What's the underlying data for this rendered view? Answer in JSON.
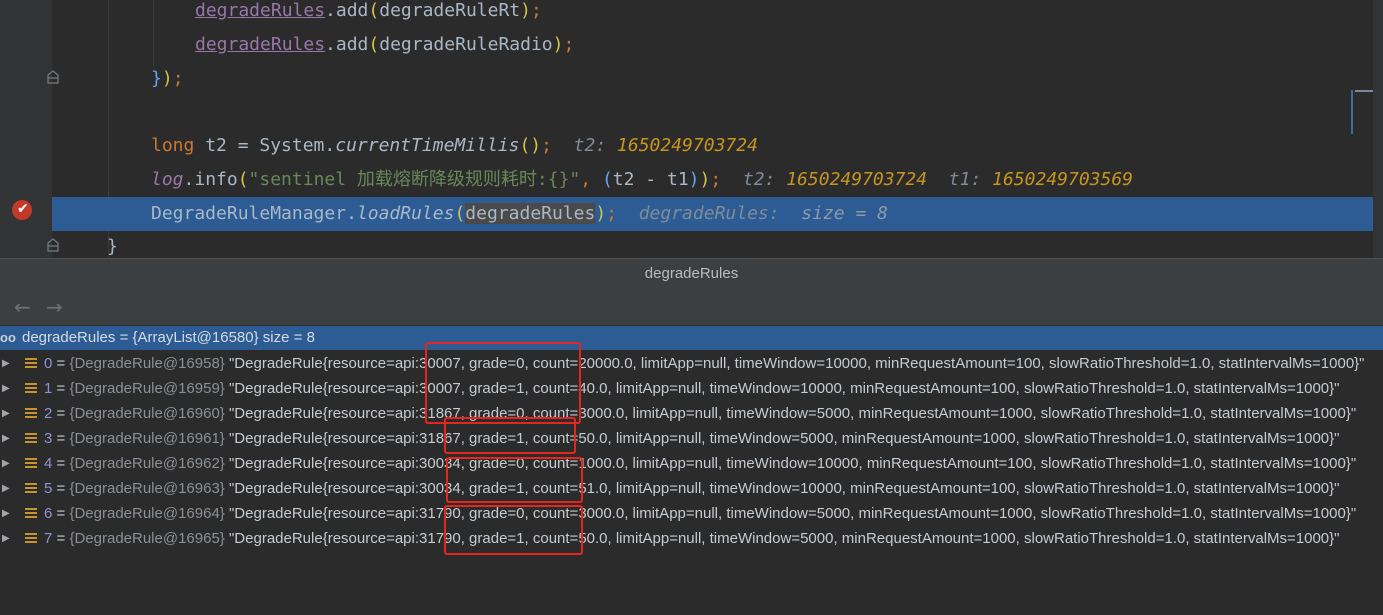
{
  "editor": {
    "lines": [
      {
        "id": "l1",
        "segments": [
          {
            "t": "degradeRules",
            "c": "ref"
          },
          {
            "t": ".add"
          },
          {
            "t": "(",
            "c": "paren-y"
          },
          {
            "t": "degradeRuleRt"
          },
          {
            "t": ")",
            "c": "paren-y"
          },
          {
            "t": ";",
            "c": "kw"
          }
        ]
      },
      {
        "id": "l2",
        "segments": [
          {
            "t": "degradeRules",
            "c": "ref"
          },
          {
            "t": ".add"
          },
          {
            "t": "(",
            "c": "paren-y"
          },
          {
            "t": "degradeRuleRadio"
          },
          {
            "t": ")",
            "c": "paren-y"
          },
          {
            "t": ";",
            "c": "kw"
          }
        ]
      },
      {
        "id": "l3",
        "segments": [
          {
            "t": "}",
            "c": "paren-b"
          },
          {
            "t": ")",
            "c": "paren-y"
          },
          {
            "t": ";",
            "c": "kw"
          }
        ]
      },
      {
        "id": "l4",
        "segments": []
      },
      {
        "id": "l5",
        "segments": [
          {
            "t": "long ",
            "c": "kw"
          },
          {
            "t": "t2 = System."
          },
          {
            "t": "currentTimeMillis",
            "c": "ital"
          },
          {
            "t": "()",
            "c": "paren-y"
          },
          {
            "t": ";",
            "c": "kw"
          },
          {
            "t": "  t2: ",
            "c": "inl-lbl"
          },
          {
            "t": "1650249703724",
            "c": "inl-val"
          }
        ]
      },
      {
        "id": "l6",
        "segments": [
          {
            "t": "log",
            "c": "fld"
          },
          {
            "t": ".info"
          },
          {
            "t": "(",
            "c": "paren-y"
          },
          {
            "t": "\"sentinel 加载熔断降级规则耗时:{}\"",
            "c": "str"
          },
          {
            "t": ", ",
            "c": "kw"
          },
          {
            "t": "(",
            "c": "paren-b"
          },
          {
            "t": "t2 - t1"
          },
          {
            "t": ")",
            "c": "paren-b"
          },
          {
            "t": ")",
            "c": "paren-y"
          },
          {
            "t": ";",
            "c": "kw"
          },
          {
            "t": "  t2: ",
            "c": "inl-lbl"
          },
          {
            "t": "1650249703724",
            "c": "inl-val"
          },
          {
            "t": "  t1: ",
            "c": "inl-lbl"
          },
          {
            "t": "1650249703569",
            "c": "inl-val"
          }
        ]
      },
      {
        "id": "l7",
        "segments": [
          {
            "t": "DegradeRuleManager."
          },
          {
            "t": "loadRules",
            "c": "ital"
          },
          {
            "t": "(",
            "c": "paren-y"
          },
          {
            "t": "degradeRules",
            "c": "match"
          },
          {
            "t": ")",
            "c": "paren-y"
          },
          {
            "t": ";",
            "c": "kw"
          },
          {
            "t": "  degradeRules:  ",
            "c": "inl-lbl"
          },
          {
            "t": "size = 8",
            "c": "inl-val2"
          }
        ]
      },
      {
        "id": "l8",
        "segments": [
          {
            "t": "}"
          }
        ]
      }
    ]
  },
  "debug_panel": {
    "title": "degradeRules",
    "nav_back": "←",
    "nav_forward": "→",
    "root": {
      "icon_label": "oo",
      "label": "degradeRules = {ArrayList@16580}  size = 8"
    },
    "items": [
      {
        "index": "0",
        "obj": "{DegradeRule@16958}",
        "value": "\"DegradeRule{resource=api:30007, grade=0, count=20000.0, limitApp=null, timeWindow=10000, minRequestAmount=100, slowRatioThreshold=1.0, statIntervalMs=1000}\""
      },
      {
        "index": "1",
        "obj": "{DegradeRule@16959}",
        "value": "\"DegradeRule{resource=api:30007, grade=1, count=40.0, limitApp=null, timeWindow=10000, minRequestAmount=100, slowRatioThreshold=1.0, statIntervalMs=1000}\""
      },
      {
        "index": "2",
        "obj": "{DegradeRule@16960}",
        "value": "\"DegradeRule{resource=api:31867, grade=0, count=3000.0, limitApp=null, timeWindow=5000, minRequestAmount=1000, slowRatioThreshold=1.0, statIntervalMs=1000}\""
      },
      {
        "index": "3",
        "obj": "{DegradeRule@16961}",
        "value": "\"DegradeRule{resource=api:31867, grade=1, count=50.0, limitApp=null, timeWindow=5000, minRequestAmount=1000, slowRatioThreshold=1.0, statIntervalMs=1000}\""
      },
      {
        "index": "4",
        "obj": "{DegradeRule@16962}",
        "value": "\"DegradeRule{resource=api:30034, grade=0, count=1000.0, limitApp=null, timeWindow=10000, minRequestAmount=100, slowRatioThreshold=1.0, statIntervalMs=1000}\""
      },
      {
        "index": "5",
        "obj": "{DegradeRule@16963}",
        "value": "\"DegradeRule{resource=api:30034, grade=1, count=51.0, limitApp=null, timeWindow=10000, minRequestAmount=100, slowRatioThreshold=1.0, statIntervalMs=1000}\""
      },
      {
        "index": "6",
        "obj": "{DegradeRule@16964}",
        "value": "\"DegradeRule{resource=api:31790, grade=0, count=3000.0, limitApp=null, timeWindow=5000, minRequestAmount=1000, slowRatioThreshold=1.0, statIntervalMs=1000}\""
      },
      {
        "index": "7",
        "obj": "{DegradeRule@16965}",
        "value": "\"DegradeRule{resource=api:31790, grade=1, count=50.0, limitApp=null, timeWindow=5000, minRequestAmount=1000, slowRatioThreshold=1.0, statIntervalMs=1000}\""
      }
    ]
  },
  "colors": {
    "annotation_box": "#e5261f",
    "selection": "#2d5c94"
  }
}
